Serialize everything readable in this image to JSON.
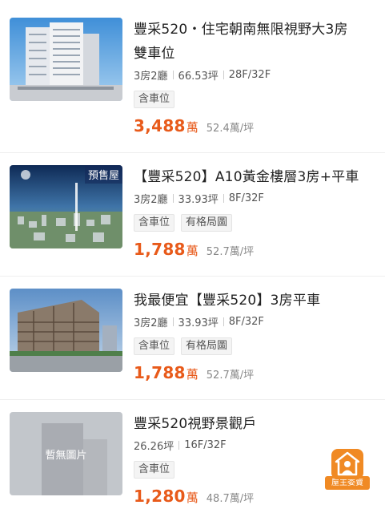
{
  "listings": [
    {
      "title_line1": "豐采520・住宅朝南無限視野大3房",
      "title_line2": "雙車位",
      "layout": "3房2廳",
      "area": "66.53坪",
      "floor": "28F/32F",
      "tags": [
        "含車位"
      ],
      "price": "3,488",
      "price_unit": "萬",
      "price_per_ping": "52.4萬/坪"
    },
    {
      "title_line1": "【豐采520】A10黃金樓層3房+平車",
      "image_badge": "預售屋",
      "layout": "3房2廳",
      "area": "33.93坪",
      "floor": "8F/32F",
      "tags": [
        "含車位",
        "有格局圖"
      ],
      "price": "1,788",
      "price_unit": "萬",
      "price_per_ping": "52.7萬/坪"
    },
    {
      "title_line1": "我最便宜【豐采520】3房平車",
      "layout": "3房2廳",
      "area": "33.93坪",
      "floor": "8F/32F",
      "tags": [
        "含車位",
        "有格局圖"
      ],
      "price": "1,788",
      "price_unit": "萬",
      "price_per_ping": "52.7萬/坪"
    },
    {
      "title_line1": "豐采520視野景觀戶",
      "image_placeholder": "暫無圖片",
      "area": "26.26坪",
      "floor": "16F/32F",
      "tags": [
        "含車位"
      ],
      "price": "1,280",
      "price_unit": "萬",
      "price_per_ping": "48.7萬/坪"
    }
  ],
  "owner_badge": {
    "label": "屋主委賣",
    "icon": "house-person-icon"
  },
  "colors": {
    "price": "#e85a1a",
    "badge": "#f08a24"
  }
}
